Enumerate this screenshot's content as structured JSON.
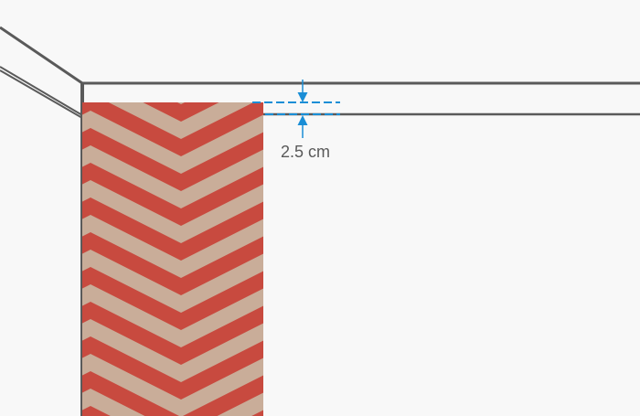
{
  "diagram": {
    "measurement_label": "2.5 cm",
    "colors": {
      "background": "#f8f8f8",
      "outline": "#5a5a5a",
      "chevron_red": "#c84a3f",
      "chevron_tan": "#c9ad99",
      "dimension_blue": "#1a8ed6"
    },
    "icons": [
      "dimension-arrow-down-icon",
      "dimension-arrow-up-icon"
    ]
  }
}
